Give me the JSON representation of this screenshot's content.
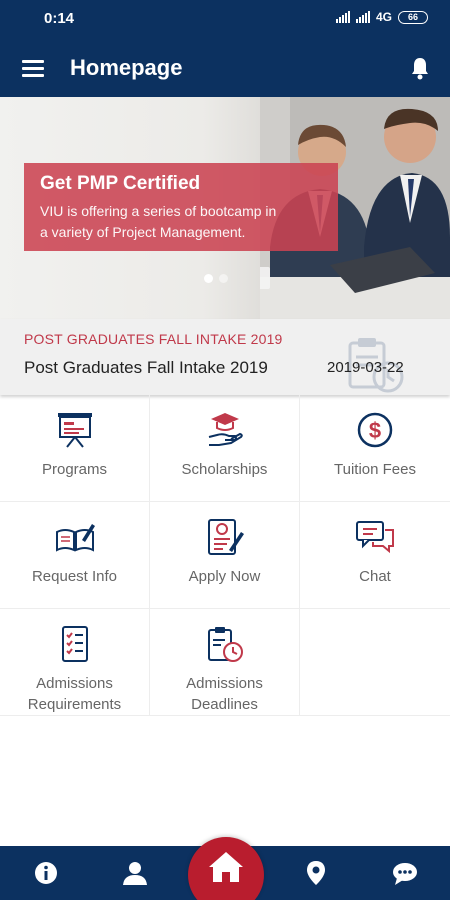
{
  "status_bar": {
    "time": "0:14",
    "network": "4G",
    "battery": "66"
  },
  "app_bar": {
    "title": "Homepage",
    "menu_icon": "menu-icon",
    "notification_icon": "bell-icon"
  },
  "banner": {
    "title": "Get PMP Certified",
    "text_line1": "VIU is offering a series of bootcamp in",
    "text_line2": "a variety of Project Management.",
    "slide_count": 2,
    "active_slide": 1
  },
  "news": {
    "tag": "POST GRADUATES FALL INTAKE 2019",
    "headline": "Post Graduates Fall Intake 2019",
    "date": "2019-03-22"
  },
  "tiles": [
    {
      "label": "Programs",
      "icon": "presentation-board-icon"
    },
    {
      "label": "Scholarships",
      "icon": "graduation-hand-icon"
    },
    {
      "label": "Tuition Fees",
      "icon": "dollar-coin-icon"
    },
    {
      "label": "Request Info",
      "icon": "book-pen-icon"
    },
    {
      "label": "Apply Now",
      "icon": "application-form-icon"
    },
    {
      "label": "Chat",
      "icon": "chat-bubbles-icon"
    },
    {
      "label_line1": "Admissions",
      "label_line2": "Requirements",
      "icon": "checklist-icon"
    },
    {
      "label_line1": "Admissions",
      "label_line2": "Deadlines",
      "icon": "clipboard-clock-icon"
    }
  ],
  "bottom_nav": {
    "items": [
      "info-icon",
      "profile-icon",
      "home-icon",
      "location-pin-icon",
      "chat-icon"
    ],
    "active": "home-icon"
  },
  "colors": {
    "primary": "#0c3160",
    "accent_red": "#b91d2e",
    "banner_card": "#cb4352",
    "tag_red": "#c0394a"
  }
}
